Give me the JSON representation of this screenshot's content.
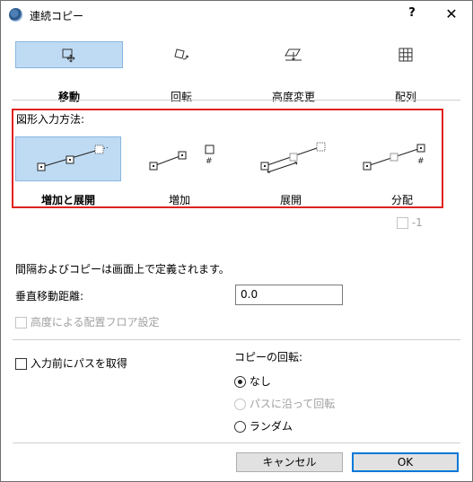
{
  "window": {
    "title": "連続コピー",
    "help": "?",
    "close": "✕"
  },
  "tabs": [
    {
      "label": "移動",
      "icon": "move-icon",
      "active": true
    },
    {
      "label": "回転",
      "icon": "rotate-icon",
      "active": false
    },
    {
      "label": "高度変更",
      "icon": "elevate-icon",
      "active": false
    },
    {
      "label": "配列",
      "icon": "array-grid-icon",
      "active": false
    }
  ],
  "method": {
    "title": "図形入力方法:",
    "options": [
      {
        "label": "増加と展開",
        "active": true
      },
      {
        "label": "増加",
        "active": false
      },
      {
        "label": "展開",
        "active": false
      },
      {
        "label": "分配",
        "active": false
      }
    ],
    "minus_one_label": "-1"
  },
  "info_text": "間隔およびコピーは画面上で定義されます。",
  "vertical_distance": {
    "label": "垂直移動距離:",
    "value": "0.0"
  },
  "floor_setting_label": "高度による配置フロア設定",
  "path_checkbox_label": "入力前にパスを取得",
  "copy_rotation": {
    "title": "コピーの回転:",
    "options": [
      {
        "label": "なし",
        "selected": true,
        "enabled": true
      },
      {
        "label": "パスに沿って回転",
        "selected": false,
        "enabled": false
      },
      {
        "label": "ランダム",
        "selected": false,
        "enabled": true
      }
    ]
  },
  "buttons": {
    "cancel": "キャンセル",
    "ok": "OK"
  }
}
